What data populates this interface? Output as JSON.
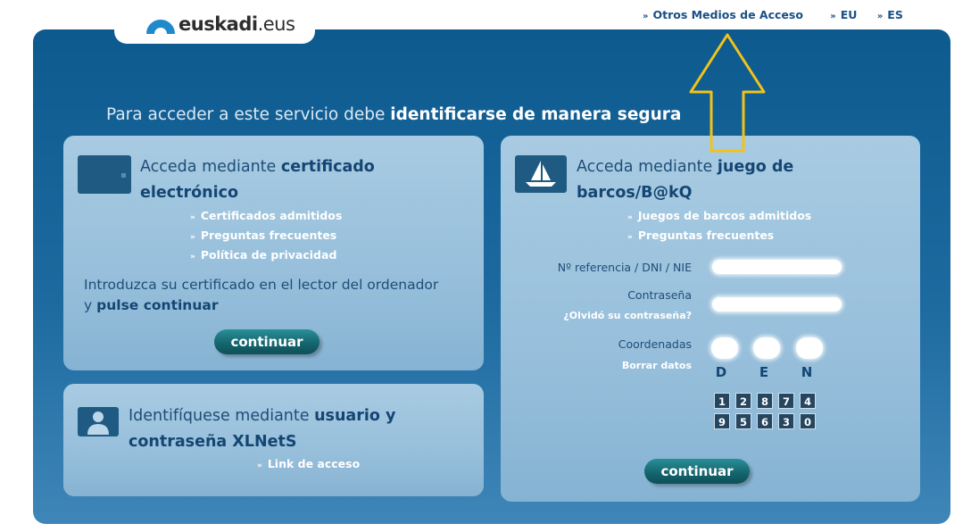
{
  "topnav": {
    "other_access": "Otros Medios de Acceso",
    "lang_eu": "EU",
    "lang_es": "ES",
    "chevron": "»"
  },
  "logo": {
    "name_bold": "euskadi",
    "name_suffix": ".eus",
    "icon": "arch-logo-icon",
    "color": "#1f89c9"
  },
  "headline": {
    "prefix": "Para acceder a este servicio debe",
    "bold": "identificarse de manera segura"
  },
  "certificate": {
    "title_prefix": "Acceda mediante",
    "title_bold_1": "certificado",
    "title_bold_2": "electrónico",
    "icon": "id-card-icon",
    "links": [
      "Certificados admitidos",
      "Preguntas frecuentes",
      "Política de privacidad"
    ],
    "instruction_line1": "Introduzca su certificado en el lector del ordenador",
    "instruction_line2_prefix": "y",
    "instruction_line2_bold": "pulse continuar",
    "button": "continuar"
  },
  "xlnets": {
    "title_prefix": "Identifíquese mediante",
    "title_bold_1": "usuario y",
    "title_bold_2": "contraseña XLNetS",
    "icon": "user-icon",
    "link": "Link de acceso"
  },
  "bakq": {
    "title_prefix": "Acceda mediante",
    "title_bold_1": "juego de",
    "title_bold_2": "barcos/B@kQ",
    "icon": "sailboat-icon",
    "links": [
      "Juegos de barcos admitidos",
      "Preguntas frecuentes"
    ],
    "ref_label": "Nº referencia / DNI / NIE",
    "password_label": "Contraseña",
    "forgot_link": "¿Olvidó su contraseña?",
    "coords_label": "Coordenadas",
    "clear_link": "Borrar datos",
    "coord_letters": [
      "D",
      "E",
      "N"
    ],
    "keypad_rows": [
      [
        "1",
        "2",
        "8",
        "7",
        "4"
      ],
      [
        "9",
        "5",
        "6",
        "3",
        "0"
      ]
    ],
    "button": "continuar"
  },
  "colors": {
    "panel": "#0d5a8f",
    "card": "#a8cbe2",
    "button": "#16666f",
    "annotation_arrow": "#f2c21a"
  }
}
